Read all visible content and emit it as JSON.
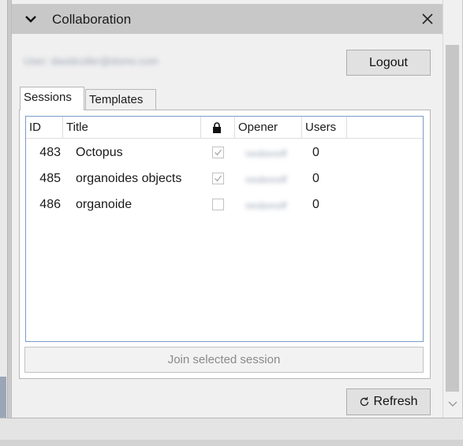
{
  "header": {
    "title": "Collaboration"
  },
  "user": {
    "label": "User: davidcoller@domo.com"
  },
  "buttons": {
    "logout": "Logout",
    "refresh": "Refresh",
    "join": "Join selected session"
  },
  "tabs": [
    {
      "label": "Sessions",
      "active": true
    },
    {
      "label": "Templates",
      "active": false
    }
  ],
  "table": {
    "columns": [
      "ID",
      "Title",
      "lock-icon",
      "Opener",
      "Users"
    ],
    "rows": [
      {
        "id": "483",
        "title": "Octopus",
        "locked": true,
        "opener": "nesbonoff",
        "users": "0"
      },
      {
        "id": "485",
        "title": "organoides objects",
        "locked": true,
        "opener": "nesbonoff",
        "users": "0"
      },
      {
        "id": "486",
        "title": "organoide",
        "locked": false,
        "opener": "nesbonoff",
        "users": "0"
      }
    ]
  },
  "icons": {
    "collapse": "chevron-down-icon",
    "close": "close-icon",
    "lock": "lock-icon",
    "refresh": "refresh-icon",
    "scroll_down": "scroll-down-icon"
  },
  "colors": {
    "header_bg": "#c8c8c8",
    "list_border": "#7a9cc6",
    "panel_bg": "#f0f0f0"
  }
}
